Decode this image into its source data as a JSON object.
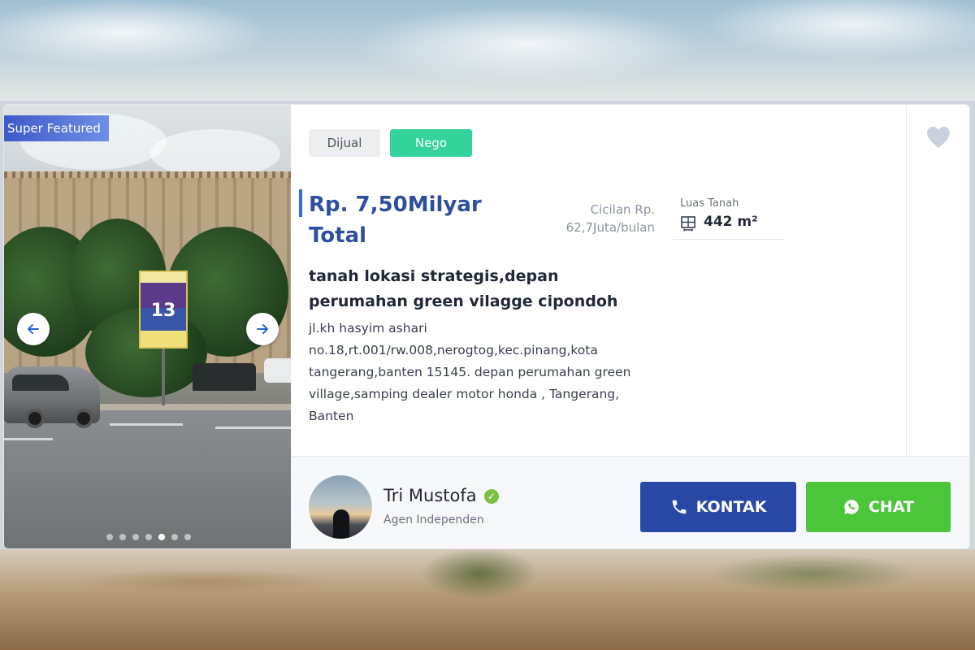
{
  "listing": {
    "featured_badge": "Super Featured",
    "tags": [
      "Dijual",
      "Nego"
    ],
    "price": "Rp. 7,50Milyar Total",
    "installment": "Cicilan Rp. 62,7Juta/bulan",
    "land_area_label": "Luas Tanah",
    "land_area_value": "442 m²",
    "title": "tanah lokasi strategis,depan perumahan green vilagge cipondoh",
    "address": "jl.kh hasyim ashari no.18,rt.001/rw.008,nerogtog,kec.pinang,kota tangerang,banten 15145. depan perumahan green village,samping dealer motor honda , Tangerang, Banten",
    "billboard_text": "13"
  },
  "gallery": {
    "slide_count": 7,
    "active_index": 4
  },
  "agent": {
    "name": "Tri Mustofa",
    "role": "Agen Independen",
    "verified_icon": "check-circle-icon"
  },
  "actions": {
    "contact_label": "KONTAK",
    "chat_label": "CHAT",
    "contact_icon": "phone-icon",
    "chat_icon": "whatsapp-icon"
  },
  "colors": {
    "price": "#2e4fa1",
    "nego": "#34d399",
    "kontak": "#2947a5",
    "chat": "#4bc53a",
    "featured": "#3d59c9"
  }
}
